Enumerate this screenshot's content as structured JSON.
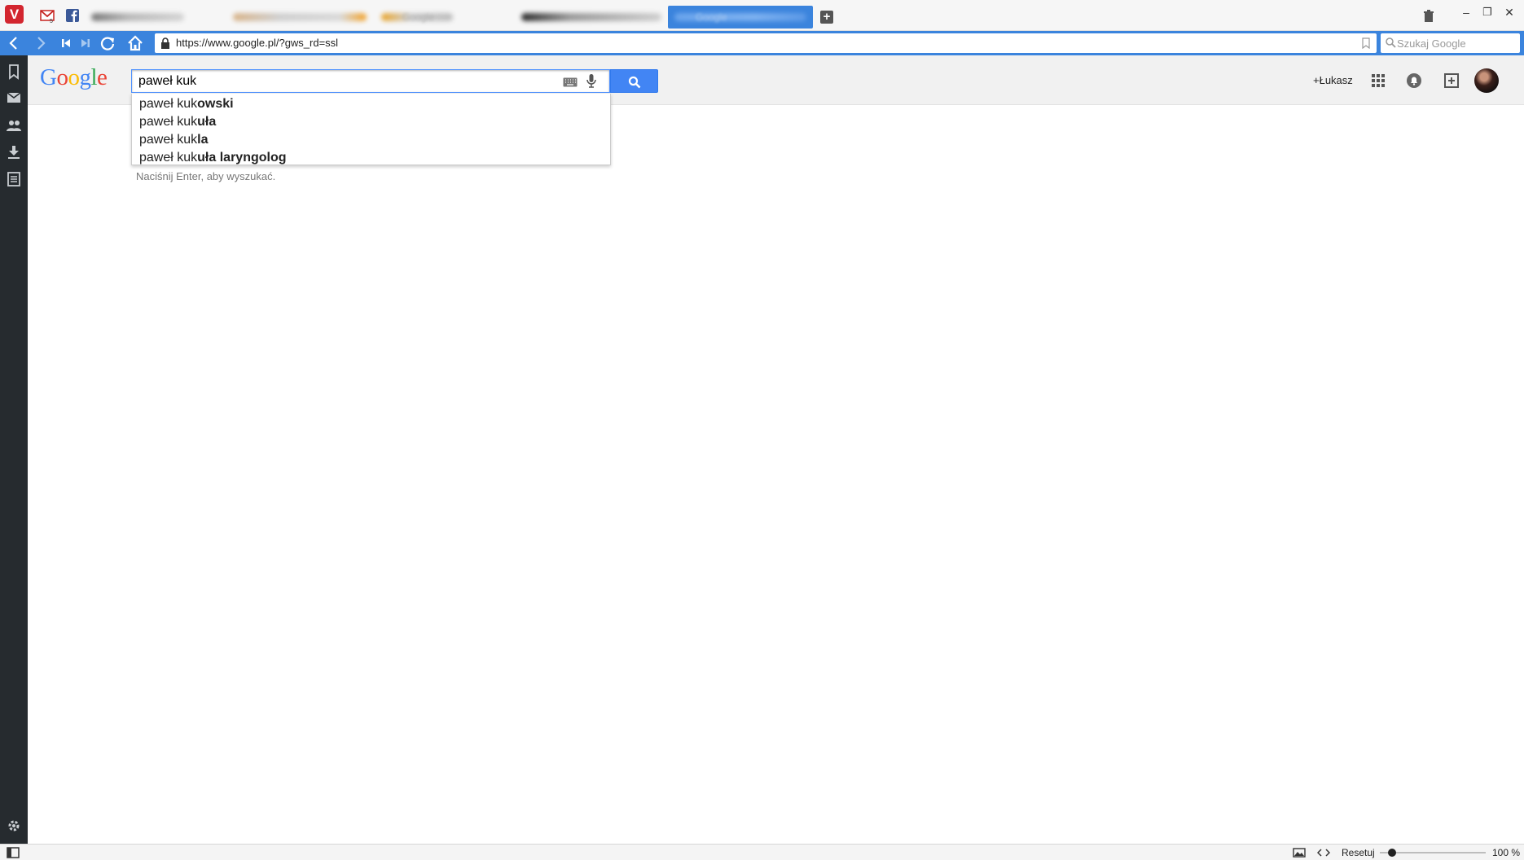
{
  "browser": {
    "tabs": [
      {
        "label": "",
        "active": false
      },
      {
        "label": "",
        "active": false
      },
      {
        "label": "Google",
        "active": false
      },
      {
        "label": "",
        "active": false
      },
      {
        "label": "Google",
        "active": true
      }
    ],
    "new_tab_icon": "plus-icon",
    "url": "https://www.google.pl/?gws_rd=ssl",
    "search_placeholder": "Szukaj Google",
    "accent_color": "#3b84dd"
  },
  "google": {
    "logo_text": "Google",
    "query": "paweł kuk",
    "suggestions": [
      {
        "typed": "paweł kuk",
        "completion": "owski"
      },
      {
        "typed": "paweł kuk",
        "completion": "uła"
      },
      {
        "typed": "paweł kuk",
        "completion": "la"
      },
      {
        "typed": "paweł kuk",
        "completion": "uła laryngolog"
      }
    ],
    "hint": "Naciśnij Enter, aby wyszukać.",
    "plus_user": "+Łukasz"
  },
  "statusbar": {
    "reset_label": "Resetuj",
    "zoom": "100 %",
    "zoom_fraction": 1.0
  }
}
